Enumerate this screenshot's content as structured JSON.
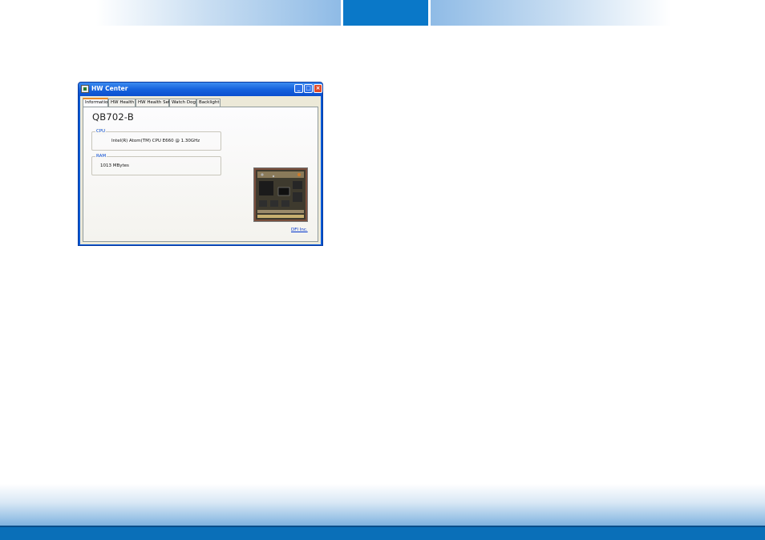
{
  "window": {
    "title": "HW Center",
    "buttons": {
      "minimize": "_",
      "maximize": "□",
      "close": "×"
    }
  },
  "tabs": [
    {
      "label": "Information",
      "active": true
    },
    {
      "label": "HW Health",
      "active": false
    },
    {
      "label": "HW Health Set",
      "active": false
    },
    {
      "label": "Watch Dog",
      "active": false
    },
    {
      "label": "Backlight",
      "active": false
    }
  ],
  "info": {
    "model": "QB702-B",
    "cpu": {
      "legend": "CPU",
      "value": "Intel(R) Atom(TM) CPU E660   @ 1.30GHz"
    },
    "ram": {
      "legend": "RAM",
      "value": "1013 MBytes"
    },
    "link": "DFI Inc."
  },
  "icons": [
    "app-icon",
    "minimize-icon",
    "maximize-icon",
    "close-icon"
  ],
  "colors": {
    "header_accent": "#0a78c8",
    "titlebar": "#1662dd",
    "tab_highlight": "#e68b2c",
    "legend": "#0046d5",
    "link": "#0033cc"
  }
}
